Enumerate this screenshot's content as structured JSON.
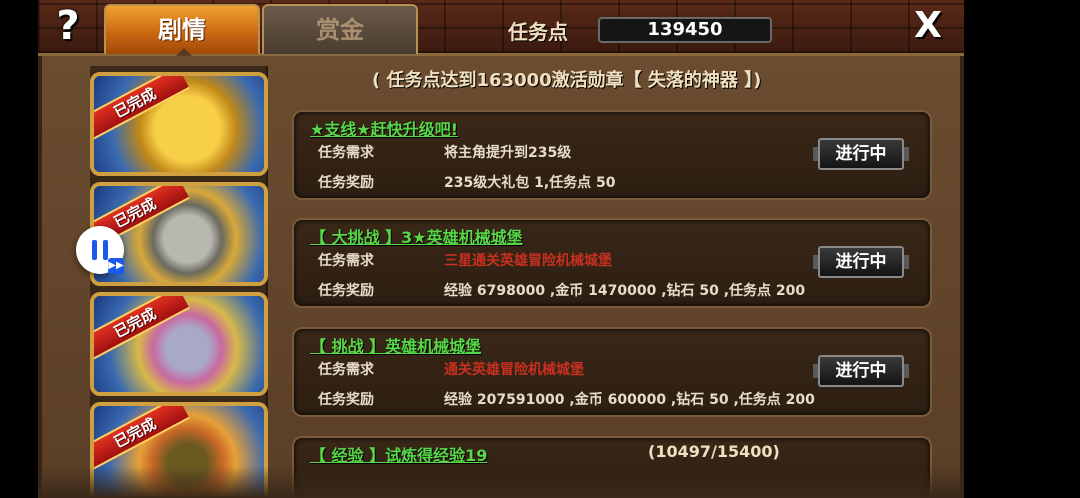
{
  "header": {
    "help_glyph": "?",
    "tabs": [
      {
        "label": "剧情",
        "active": true
      },
      {
        "label": "赏金",
        "active": false
      }
    ],
    "points_label": "任务点",
    "points_value": "139450",
    "close_glyph": "X"
  },
  "banner": "( 任务点达到163000激活勋章【 失落的神器 】)",
  "medals": [
    {
      "badge": "已完成",
      "icon": "gold-helmet-medal-icon"
    },
    {
      "badge": "已完成",
      "icon": "skull-medal-icon"
    },
    {
      "badge": "已完成",
      "icon": "crystal-shield-medal-icon"
    },
    {
      "badge": "已完成",
      "icon": "beast-medal-icon"
    }
  ],
  "quests": [
    {
      "title": "★支线★赶快升级吧!",
      "req_label": "任务需求",
      "req": "将主角提升到235级",
      "req_met": true,
      "reward_label": "任务奖励",
      "reward": "235级大礼包 1,任务点 50",
      "status": "进行中"
    },
    {
      "title": "【 大挑战 】3★英雄机械城堡",
      "req_label": "任务需求",
      "req": "三星通关英雄冒险机械城堡",
      "req_met": false,
      "reward_label": "任务奖励",
      "reward": "经验 6798000 ,金币 1470000 ,钻石 50 ,任务点 200",
      "status": "进行中"
    },
    {
      "title": "【 挑战 】英雄机械城堡",
      "req_label": "任务需求",
      "req": "通关英雄冒险机械城堡",
      "req_met": false,
      "reward_label": "任务奖励",
      "reward": "经验 207591000 ,金币 600000 ,钻石 50 ,任务点 200",
      "status": "进行中"
    },
    {
      "title": "【 经验 】试炼得经验19",
      "progress": "(10497/15400)"
    }
  ],
  "colors": {
    "quest_title": "#58d848",
    "requirement_unmet": "#c83020",
    "tab_active": "#c86410"
  }
}
